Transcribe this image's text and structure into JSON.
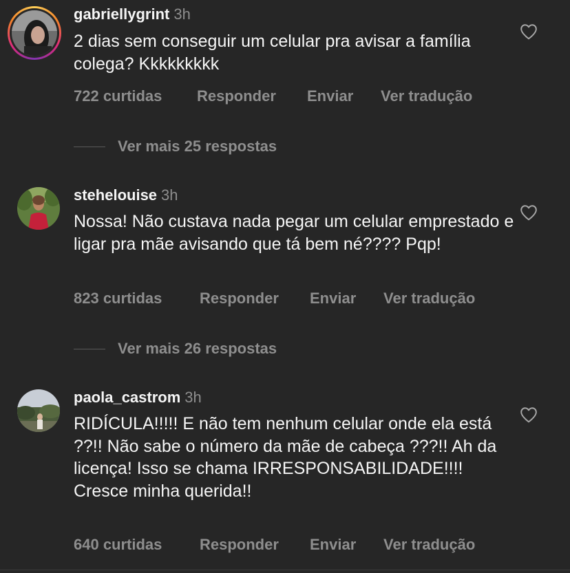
{
  "comments": [
    {
      "username": "gabriellygrint",
      "time": "3h",
      "text": "2 dias sem conseguir um celular pra avisar a família colega? Kkkkkkkkk",
      "likes": "722 curtidas",
      "reply": "Responder",
      "send": "Enviar",
      "translate": "Ver tradução",
      "more_replies": "Ver mais 25 respostas",
      "has_story": true
    },
    {
      "username": "stehelouise",
      "time": "3h",
      "text": "Nossa! Não custava nada pegar um celular emprestado e ligar pra mãe avisando que tá bem né???? Pqp!",
      "likes": "823 curtidas",
      "reply": "Responder",
      "send": "Enviar",
      "translate": "Ver tradução",
      "more_replies": "Ver mais 26 respostas",
      "has_story": false
    },
    {
      "username": "paola_castrom",
      "time": "3h",
      "text": "RIDÍCULA!!!!! E não tem nenhum celular onde ela está ??!! Não sabe o número da mãe de cabeça ???!! Ah da licença! Isso se chama IRRESPONSABILIDADE!!!! Cresce minha querida!!",
      "likes": "640 curtidas",
      "reply": "Responder",
      "send": "Enviar",
      "translate": "Ver tradução",
      "has_story": false
    }
  ],
  "icons": {
    "like": "heart-outline-icon"
  },
  "colors": {
    "background": "#262626",
    "primary_text": "#f5f5f5",
    "secondary_text": "#8e8e8e"
  }
}
